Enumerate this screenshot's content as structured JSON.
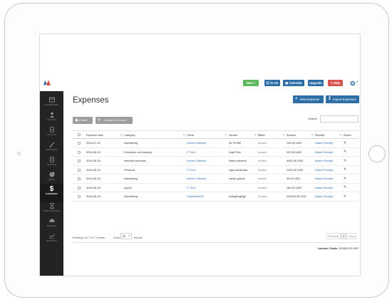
{
  "colors": {
    "primary": "#2d6ea7",
    "new_button": "#5cb85c",
    "upgrade_button": "#2d6ea7",
    "help_button": "#d9534f",
    "sidebar_bg": "#232323",
    "link": "#2f6fb0"
  },
  "header": {
    "buttons": [
      {
        "label": "New",
        "icon": "plus-icon"
      },
      {
        "label": "To Do",
        "icon": "checkbox-icon"
      },
      {
        "label": "Calendar",
        "icon": "calendar-icon"
      },
      {
        "label": "Upgrade",
        "icon": ""
      },
      {
        "label": "Help",
        "icon": "question-icon"
      }
    ],
    "settings_icon": "gear-icon"
  },
  "sidebar": {
    "items": [
      {
        "label": "DASHBOARD",
        "icon": "dashboard-icon",
        "active": false
      },
      {
        "label": "PEOPLE",
        "icon": "people-icon",
        "active": false
      },
      {
        "label": "INVOICE",
        "icon": "invoice-icon",
        "active": false
      },
      {
        "label": "CONTRACT",
        "icon": "contract-icon",
        "active": false
      },
      {
        "label": "QUOTES",
        "icon": "quotes-icon",
        "active": false
      },
      {
        "label": "TASKS",
        "icon": "tasks-icon",
        "active": false
      },
      {
        "label": "EXPENSES",
        "icon": "dollar-icon",
        "active": true
      },
      {
        "label": "TIME TRACKING",
        "icon": "clock-icon",
        "active": false
      },
      {
        "label": "MILEAGE",
        "icon": "car-icon",
        "active": false
      },
      {
        "label": "REPORTS",
        "icon": "chart-icon",
        "active": false
      }
    ]
  },
  "page": {
    "title": "Expenses",
    "new_expense_label": "New Expense",
    "import_expenses_label": "Import Expenses",
    "delete_label": "Delete",
    "convert_label": "Convert to Invoice",
    "search_label": "Search:",
    "search_value": ""
  },
  "table": {
    "columns": [
      "",
      "Expense date",
      "Category",
      "Client",
      "Vendor",
      "Billed",
      "Amount",
      "Receipt",
      "Action"
    ],
    "rows": [
      {
        "date": "2016-07-01",
        "category": "Advertising",
        "client": "Amine Software",
        "vendor": "Air Tel Bill",
        "billed": "Invoice",
        "amount": "100.00 USD",
        "receipt": "Attach Receipt"
      },
      {
        "date": "2016-06-24",
        "category": "Education and training",
        "client": "IT Tech",
        "vendor": "Kapil Sha",
        "billed": "Invoice",
        "amount": "200.00 USD",
        "receipt": "Attach Receipt"
      },
      {
        "date": "2016-06-24",
        "category": "Internet expenses",
        "client": "Amine Software",
        "vendor": "Netrix infotech",
        "billed": "Invoice",
        "amount": "4000.00 USD",
        "receipt": "Attach Receipt"
      },
      {
        "date": "2016-06-24",
        "category": "Personal",
        "client": "IT Tech",
        "vendor": "vijay electricals",
        "billed": "Invoice",
        "amount": "1000.00 USD",
        "receipt": "Attach Receipt"
      },
      {
        "date": "2016-06-24",
        "category": "Advertising",
        "client": "Amine Software",
        "vendor": "vishal optical",
        "billed": "Invoice",
        "amount": "30.00 USD",
        "receipt": "Attach Receipt"
      },
      {
        "date": "2016-06-09",
        "category": "sports",
        "client": "IT Tech",
        "vendor": "",
        "billed": "Invoice",
        "amount": "180.00 USD",
        "receipt": "Attach Receipt"
      },
      {
        "date": "2016-06-24",
        "category": "Advertising",
        "client": "Sanfdhfsd231",
        "vendor": "hcfhgfvhgfvgh",
        "billed": "Invoice",
        "amount": "100000.00 USD",
        "receipt": "Attach Receipt"
      }
    ]
  },
  "footer": {
    "showing": "Showing 1 to 7 of 7 entries",
    "show_label": "Show",
    "page_size": "50",
    "entries_label": "entries",
    "prev": "Previous",
    "page": "1",
    "next": "Next",
    "totals_label": "Amount Totals:",
    "totals_value": "105430.00 USD"
  }
}
